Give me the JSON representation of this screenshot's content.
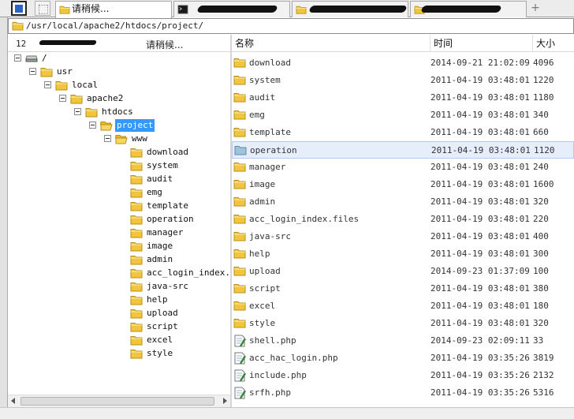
{
  "tabs": [
    {
      "label": "请稍候...",
      "active": true
    }
  ],
  "path": "/usr/local/apache2/htdocs/project/",
  "tree_header": {
    "ip": "12",
    "loading": "请稍候..."
  },
  "tree": {
    "nodes": [
      {
        "label": "/",
        "level": 0,
        "type": "drive",
        "expanded": true
      },
      {
        "label": "usr",
        "level": 1,
        "type": "folder",
        "expanded": true
      },
      {
        "label": "local",
        "level": 2,
        "type": "folder",
        "expanded": true
      },
      {
        "label": "apache2",
        "level": 3,
        "type": "folder",
        "expanded": true
      },
      {
        "label": "htdocs",
        "level": 4,
        "type": "folder",
        "expanded": true
      },
      {
        "label": "project",
        "level": 5,
        "type": "folder-open",
        "expanded": true,
        "selected": true
      },
      {
        "label": "www",
        "level": 6,
        "type": "folder-open",
        "expanded": true
      },
      {
        "label": "download",
        "level": 7,
        "type": "folder"
      },
      {
        "label": "system",
        "level": 7,
        "type": "folder"
      },
      {
        "label": "audit",
        "level": 7,
        "type": "folder"
      },
      {
        "label": "emg",
        "level": 7,
        "type": "folder"
      },
      {
        "label": "template",
        "level": 7,
        "type": "folder"
      },
      {
        "label": "operation",
        "level": 7,
        "type": "folder"
      },
      {
        "label": "manager",
        "level": 7,
        "type": "folder"
      },
      {
        "label": "image",
        "level": 7,
        "type": "folder"
      },
      {
        "label": "admin",
        "level": 7,
        "type": "folder"
      },
      {
        "label": "acc_login_index.files",
        "level": 7,
        "type": "folder"
      },
      {
        "label": "java-src",
        "level": 7,
        "type": "folder"
      },
      {
        "label": "help",
        "level": 7,
        "type": "folder"
      },
      {
        "label": "upload",
        "level": 7,
        "type": "folder"
      },
      {
        "label": "script",
        "level": 7,
        "type": "folder"
      },
      {
        "label": "excel",
        "level": 7,
        "type": "folder"
      },
      {
        "label": "style",
        "level": 7,
        "type": "folder"
      }
    ]
  },
  "list": {
    "columns": {
      "name": "名称",
      "time": "时间",
      "size": "大小"
    },
    "rows": [
      {
        "name": "download",
        "time": "2014-09-21 21:02:09",
        "size": "4096",
        "type": "folder"
      },
      {
        "name": "system",
        "time": "2011-04-19 03:48:01",
        "size": "1220",
        "type": "folder"
      },
      {
        "name": "audit",
        "time": "2011-04-19 03:48:01",
        "size": "1180",
        "type": "folder"
      },
      {
        "name": "emg",
        "time": "2011-04-19 03:48:01",
        "size": "340",
        "type": "folder"
      },
      {
        "name": "template",
        "time": "2011-04-19 03:48:01",
        "size": "660",
        "type": "folder"
      },
      {
        "name": "operation",
        "time": "2011-04-19 03:48:01",
        "size": "1120",
        "type": "folder",
        "highlighted": true
      },
      {
        "name": "manager",
        "time": "2011-04-19 03:48:01",
        "size": "240",
        "type": "folder"
      },
      {
        "name": "image",
        "time": "2011-04-19 03:48:01",
        "size": "1600",
        "type": "folder"
      },
      {
        "name": "admin",
        "time": "2011-04-19 03:48:01",
        "size": "320",
        "type": "folder"
      },
      {
        "name": "acc_login_index.files",
        "time": "2011-04-19 03:48:01",
        "size": "220",
        "type": "folder"
      },
      {
        "name": "java-src",
        "time": "2011-04-19 03:48:01",
        "size": "400",
        "type": "folder"
      },
      {
        "name": "help",
        "time": "2011-04-19 03:48:01",
        "size": "300",
        "type": "folder"
      },
      {
        "name": "upload",
        "time": "2014-09-23 01:37:09",
        "size": "100",
        "type": "folder"
      },
      {
        "name": "script",
        "time": "2011-04-19 03:48:01",
        "size": "380",
        "type": "folder"
      },
      {
        "name": "excel",
        "time": "2011-04-19 03:48:01",
        "size": "180",
        "type": "folder"
      },
      {
        "name": "style",
        "time": "2011-04-19 03:48:01",
        "size": "320",
        "type": "folder"
      },
      {
        "name": "shell.php",
        "time": "2014-09-23 02:09:11",
        "size": "33",
        "type": "php"
      },
      {
        "name": "acc_hac_login.php",
        "time": "2011-04-19 03:35:26",
        "size": "3819",
        "type": "php"
      },
      {
        "name": "include.php",
        "time": "2011-04-19 03:35:26",
        "size": "2132",
        "type": "php"
      },
      {
        "name": "srfh.php",
        "time": "2011-04-19 03:35:26",
        "size": "5316",
        "type": "php"
      }
    ]
  },
  "colors": {
    "selection": "#3399ff",
    "folder": "#f2c53d",
    "highlight_row": "#e6edfb"
  },
  "icons": {
    "folder": "folder-icon",
    "folder_open": "folder-open-icon",
    "drive": "drive-icon",
    "php": "php-file-icon",
    "terminal": "terminal-icon"
  }
}
